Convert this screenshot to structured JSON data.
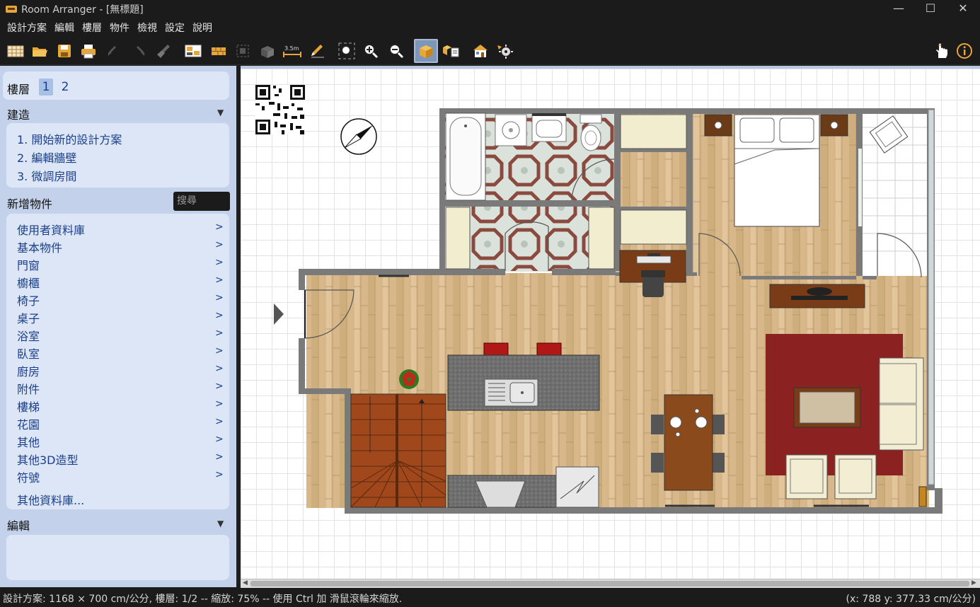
{
  "window": {
    "title": "Room Arranger - [無標題]",
    "minimize": "—",
    "maximize": "☐",
    "close": "✕"
  },
  "menu": [
    "設計方案",
    "編輯",
    "樓層",
    "物件",
    "檢視",
    "設定",
    "說明"
  ],
  "toolbar": {
    "icons": [
      "new-project-icon",
      "open-icon",
      "save-icon",
      "print-icon",
      "undo-icon",
      "redo-icon",
      "clean-icon",
      "floor-plan-icon",
      "wall-icon",
      "group-icon",
      "3d-objects-icon",
      "dimension-icon",
      "pencil-icon",
      "zoom-fit-icon",
      "zoom-in-icon",
      "zoom-out-icon",
      "3d-view-icon",
      "multi-view-icon",
      "house-view-icon",
      "settings-icon",
      "hand-icon",
      "info-icon"
    ],
    "dimension_label": "3.5m",
    "accent": "#e8a53a"
  },
  "left_panel": {
    "floor_label": "樓層",
    "floors": [
      "1",
      "2"
    ],
    "build_header": "建造",
    "build_steps": [
      "1. 開始新的設計方案",
      "2. 編輯牆壁",
      "3. 微調房間"
    ],
    "add_objects_header": "新增物件",
    "search_placeholder": "搜尋",
    "categories": [
      "使用者資料庫",
      "基本物件",
      "門窗",
      "櫥櫃",
      "椅子",
      "桌子",
      "浴室",
      "臥室",
      "廚房",
      "附件",
      "樓梯",
      "花園",
      "其他",
      "其他3D造型",
      "符號"
    ],
    "more_libraries": "其他資料庫...",
    "edit_header": "編輯",
    "chevron": ">",
    "collapse_arrow": "▼"
  },
  "status": {
    "left": "設計方案: 1168 × 700 cm/公分, 樓層: 1/2 -- 縮放: 75% -- 使用 Ctrl 加 滑鼠滾輪來縮放.",
    "right": "(x: 788 y: 377.33 cm/公分)"
  },
  "colors": {
    "panel_bg": "#c3d2ea",
    "panel_box": "#dce6f7",
    "link": "#1b3f8a",
    "wall": "#7a7a7a",
    "wood_floor": "#d9b98c",
    "sofa": "#f3eed3",
    "rug": "#8b2121",
    "counter": "#6a6a6a",
    "table_wood": "#8a4a1c"
  }
}
